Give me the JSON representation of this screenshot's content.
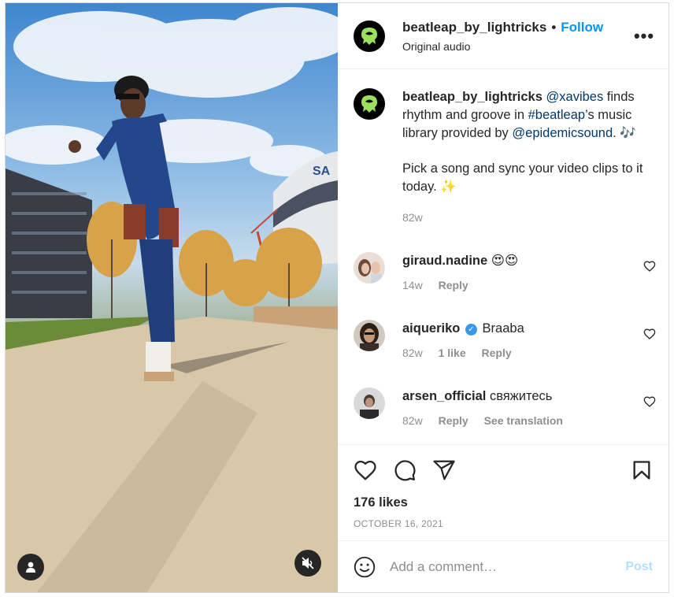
{
  "header": {
    "username": "beatleap_by_lightricks",
    "separator": "•",
    "follow_label": "Follow",
    "subtitle": "Original audio",
    "more_label": "•••"
  },
  "caption": {
    "username": "beatleap_by_lightricks",
    "line1_prefix": " ",
    "mention1": "@xavibes",
    "text1": " finds rhythm and groove in ",
    "hashtag": "#beatleap",
    "text2": "’s music library provided by ",
    "mention2": "@epidemicsound",
    "text3": ". 🎶",
    "paragraph2": "Pick a song and sync your video clips to it today. ✨",
    "time": "82w"
  },
  "comments": [
    {
      "username": "giraud.nadine",
      "text": " 😍😍",
      "time": "14w",
      "reply_label": "Reply"
    },
    {
      "username": "aiqueriko",
      "verified_glyph": "✓",
      "text": " Braaba",
      "time": "82w",
      "likes_label": "1 like",
      "reply_label": "Reply"
    },
    {
      "username": "arsen_official",
      "text": " свяжитесь",
      "time": "82w",
      "reply_label": "Reply",
      "translate_label": "See translation"
    }
  ],
  "actions": {
    "icons": [
      "heart-icon",
      "comment-icon",
      "share-icon",
      "bookmark-icon"
    ],
    "likes": "176 likes",
    "date": "OCTOBER 16, 2021"
  },
  "add_comment": {
    "placeholder": "Add a comment…",
    "post_label": "Post"
  },
  "colors": {
    "accent": "#0095f6",
    "link": "#00376b",
    "muted": "#8e8e8e",
    "post_disabled": "#b2dffc",
    "logo_green": "#9be15d"
  }
}
